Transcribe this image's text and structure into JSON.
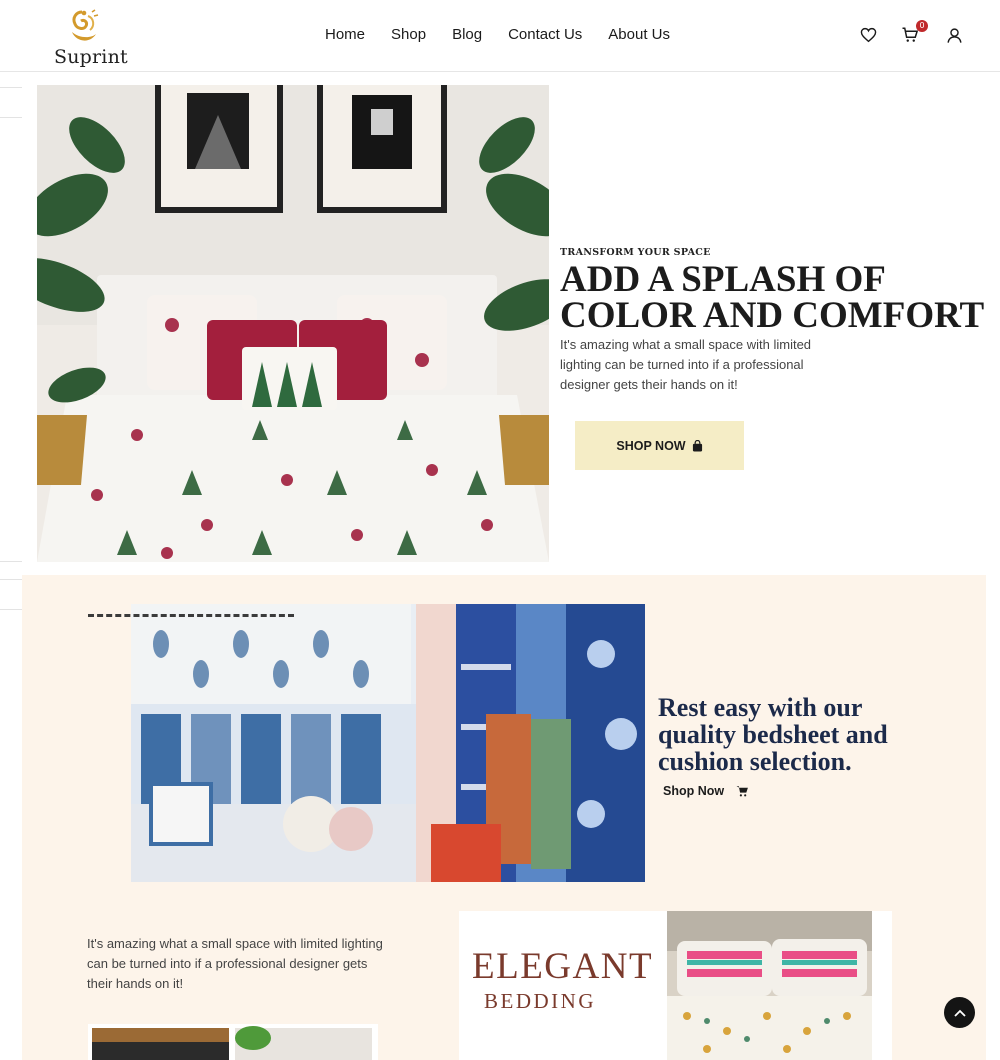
{
  "header": {
    "logo_text": "Suprint",
    "nav": [
      "Home",
      "Shop",
      "Blog",
      "Contact Us",
      "About Us"
    ],
    "cart_count": "0",
    "icons": {
      "wishlist": "heart-icon",
      "cart": "cart-icon",
      "account": "user-icon"
    }
  },
  "hero": {
    "eyebrow": "TRANSFORM YOUR SPACE",
    "title_line1": "ADD A SPLASH OF",
    "title_line2": "COLOR AND COMFORT",
    "text": "It's amazing what a small space with limited lighting can be turned into if a professional designer gets their hands on it!",
    "button_label": "SHOP NOW",
    "button_icon": "bag-icon",
    "button_color": "#f5edc6"
  },
  "promo": {
    "title": "Rest easy with our quality bedsheet and cushion selection.",
    "link_label": "Shop Now",
    "link_icon": "cart-icon",
    "background": "#fdf4ea"
  },
  "lower": {
    "text": "It's amazing what a small space with limited lighting can be turned into if a professional designer gets their hands on it!",
    "card_title": "ELEGANT",
    "card_subtitle": "BEDDING",
    "accent": "#7a3a2c"
  },
  "scroll_top_icon": "chevron-up-icon"
}
